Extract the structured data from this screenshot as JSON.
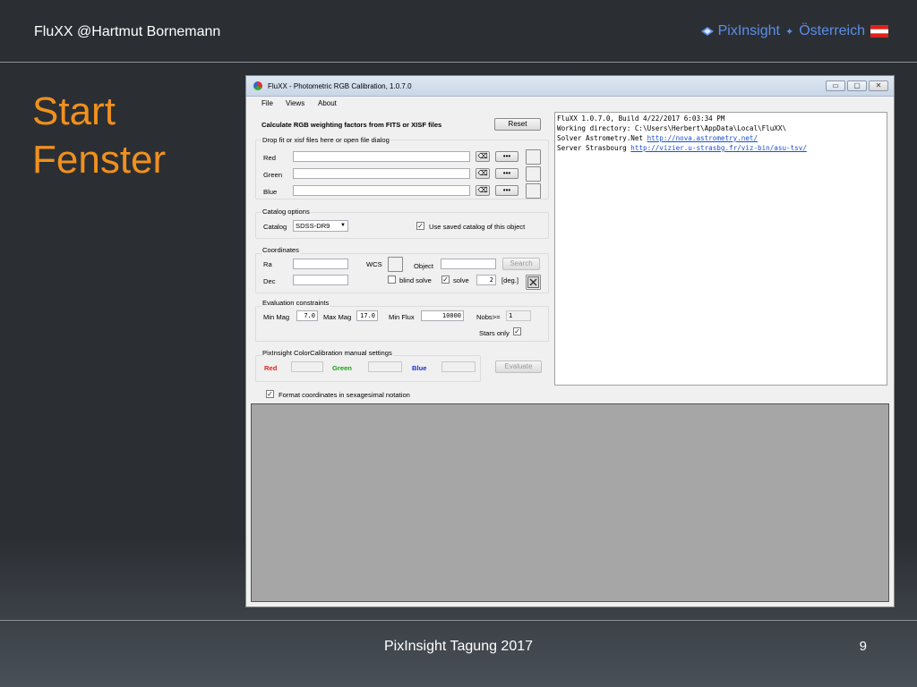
{
  "slide": {
    "header_left": "FluXX  @Hartmut Bornemann",
    "header_right_brand": "PixInsight",
    "header_right_country": "Österreich",
    "title_line1": "Start",
    "title_line2": "Fenster",
    "footer": "PixInsight Tagung 2017",
    "page_number": "9",
    "accent_color": "#f0901e",
    "brand_color": "#5b8ee6"
  },
  "window": {
    "title": "FluXX - Photometric RGB Calibration, 1.0.7.0",
    "buttons": {
      "minimize": "▭",
      "maximize": "▢",
      "close": "✕"
    },
    "menu": [
      "File",
      "Views",
      "About"
    ],
    "header_text": "Calculate RGB weighting factors from FITS or XISF files",
    "reset_label": "Reset",
    "files": {
      "group_label": "Drop fit or xisf files here or open file dialog",
      "rows": [
        {
          "label": "Red",
          "value": ""
        },
        {
          "label": "Green",
          "value": ""
        },
        {
          "label": "Blue",
          "value": ""
        }
      ],
      "clear_icon": "⌫",
      "browse_label": "•••"
    },
    "catalog": {
      "group_label": "Catalog options",
      "label": "Catalog",
      "selected": "SDSS-DR9",
      "use_saved_label": "Use saved catalog of this object",
      "use_saved_checked": "✓"
    },
    "coordinates": {
      "group_label": "Coordinates",
      "ra_label": "Ra",
      "dec_label": "Dec",
      "wcs_label": "WCS",
      "object_label": "Object",
      "search_label": "Search",
      "blind_solve_label": "blind solve",
      "solve_label": "solve",
      "solve_checked": "✓",
      "deg_value": "2",
      "deg_label": "[deg.]"
    },
    "evaluation": {
      "group_label": "Evaluation constraints",
      "min_mag_label": "Min Mag",
      "min_mag_value": "7.0",
      "max_mag_label": "Max Mag",
      "max_mag_value": "17.0",
      "min_flux_label": "Min Flux",
      "min_flux_value": "10000",
      "nobs_label": "Nobs>=",
      "nobs_value": "1",
      "stars_only_label": "Stars only",
      "stars_only_checked": "✓"
    },
    "pixinsight": {
      "group_label": "PixInsight ColorCalibration manual settings",
      "red_label": "Red",
      "green_label": "Green",
      "blue_label": "Blue",
      "evaluate_label": "Evaluate",
      "red_color": "#e0201a",
      "green_color": "#18a018",
      "blue_color": "#1a2fd0"
    },
    "format_coords_label": "Format coordinates in sexagesimal notation",
    "format_coords_checked": "✓",
    "log": {
      "line1": "FluXX 1.0.7.0, Build 4/22/2017 6:03:34 PM",
      "line2": "Working directory: C:\\Users\\Herbert\\AppData\\Local\\FluXX\\",
      "line3_prefix": "Solver Astrometry.Net ",
      "line3_link": "http://nova.astrometry.net/",
      "line4_prefix": "Server Strasbourg ",
      "line4_link": "http://vizier.u-strasbg.fr/viz-bin/asu-tsv/"
    }
  }
}
